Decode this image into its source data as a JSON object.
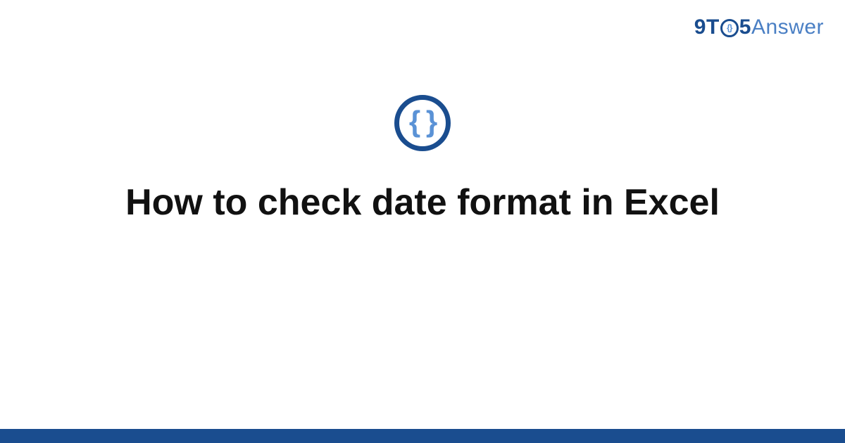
{
  "brand": {
    "nine": "9",
    "t": "T",
    "five": "5",
    "answer": "Answer",
    "inner_braces": "{}"
  },
  "icon": {
    "braces": "{ }"
  },
  "title": "How to check date format in Excel",
  "colors": {
    "primary": "#1a4d8f",
    "accent": "#5a92d6",
    "text": "#111111",
    "bg": "#ffffff"
  }
}
